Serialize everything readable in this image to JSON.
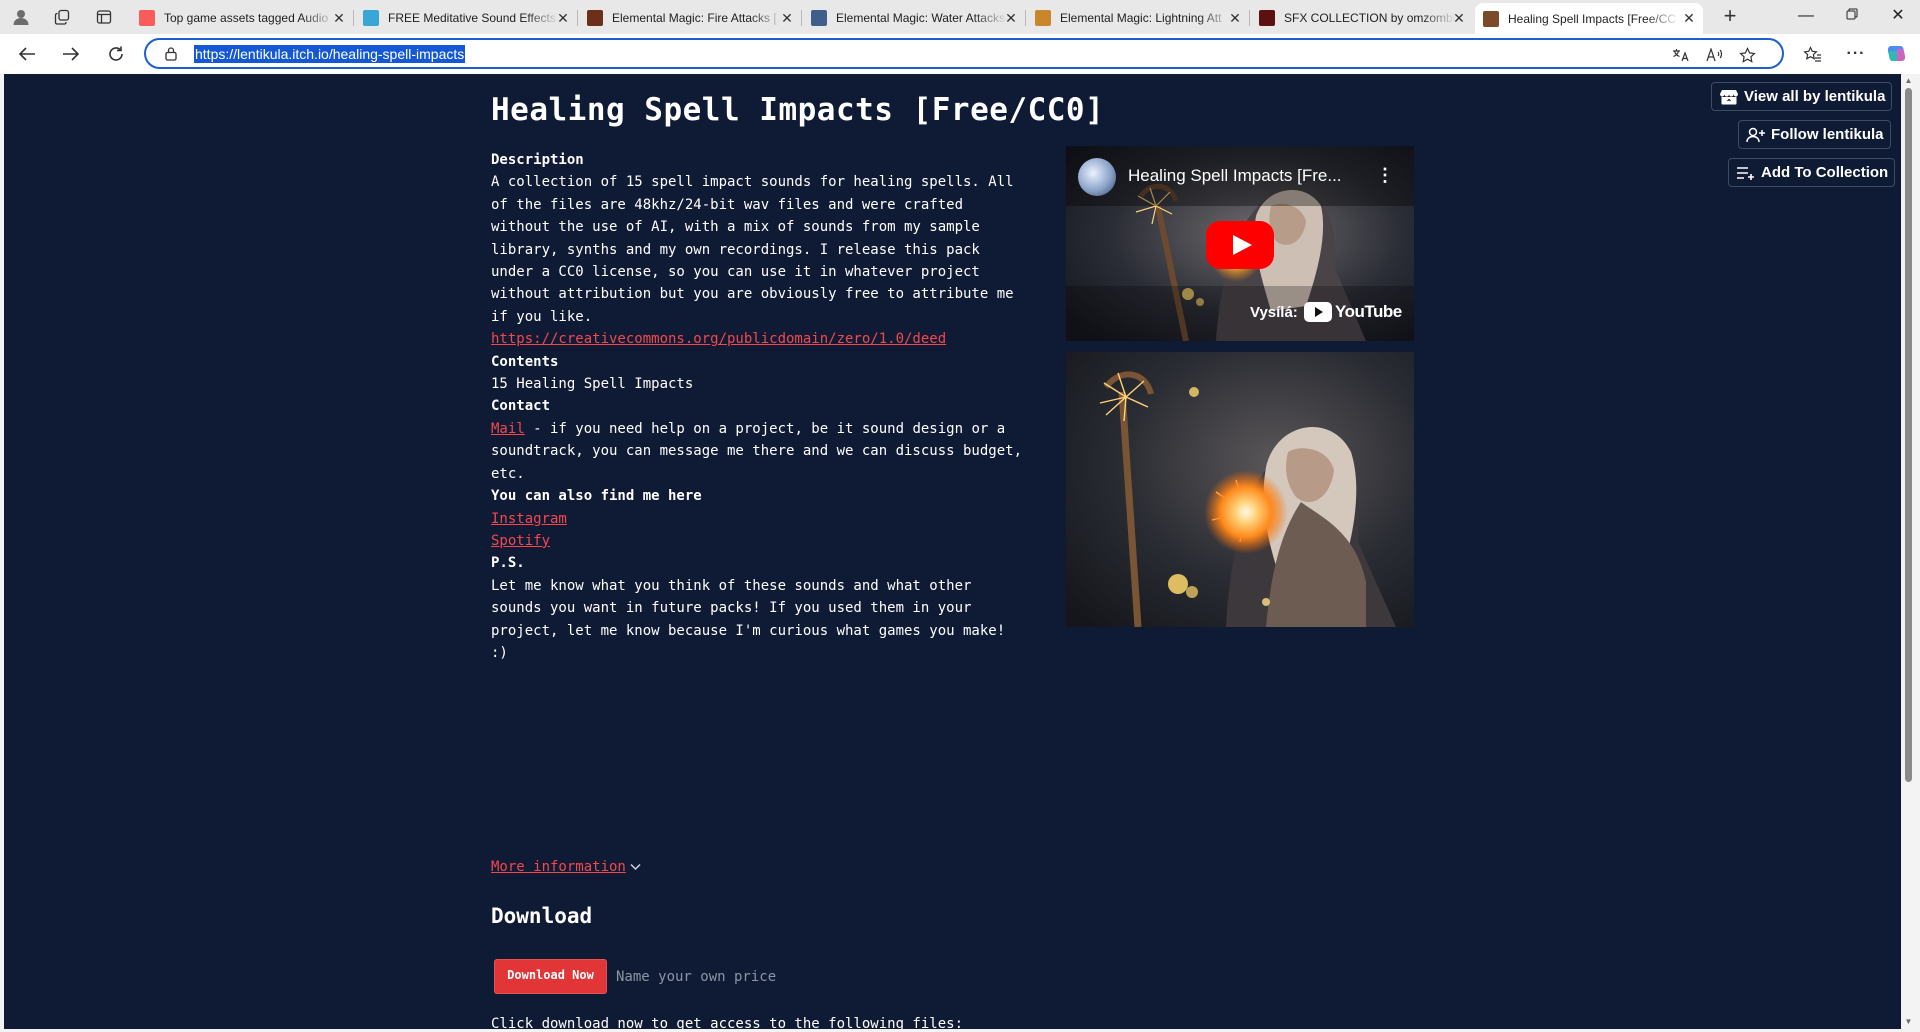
{
  "browser": {
    "tabs": [
      {
        "title": "Top game assets tagged Audio",
        "favicon_color": "#fa5c5c"
      },
      {
        "title": "FREE Meditative Sound Effects",
        "favicon_color": "#3aa6d6"
      },
      {
        "title": "Elemental Magic: Fire Attacks [",
        "favicon_color": "#6b2f1a"
      },
      {
        "title": "Elemental Magic: Water Attacks",
        "favicon_color": "#3f5f8a"
      },
      {
        "title": "Elemental Magic: Lightning Att",
        "favicon_color": "#c9872c"
      },
      {
        "title": "SFX COLLECTION by omzombie",
        "favicon_color": "#5c1010"
      },
      {
        "title": "Healing Spell Impacts [Free/CC",
        "favicon_color": "#7a4a2a"
      }
    ],
    "active_tab_index": 6,
    "url": "https://lentikula.itch.io/healing-spell-impacts",
    "accent": "#1558d6"
  },
  "page": {
    "title": "Healing Spell Impacts [Free/CC0]",
    "description_heading": "Description",
    "description_lines": [
      "A collection of 15 spell impact sounds for healing spells. All",
      "of the files are 48khz/24-bit wav files and were crafted",
      "without the use of AI, with a mix of sounds from my sample",
      "library, synths and my own recordings. I release this pack",
      "under a CC0 license, so you can use it in whatever project",
      "without attribution but you are obviously free to attribute me",
      "if you like."
    ],
    "license_link": "https://creativecommons.org/publicdomain/zero/1.0/deed",
    "contents_heading": "Contents",
    "contents_text": "15 Healing Spell Impacts",
    "contact_heading": "Contact",
    "contact_link": "Mail",
    "contact_lines": [
      " - if you need help on a project, be it sound design or a",
      "soundtrack, you can message me there and we can discuss budget,",
      "etc."
    ],
    "find_heading": "You can also find me here",
    "instagram_link": "Instagram",
    "spotify_link": "Spotify",
    "ps_heading": "P.S.",
    "ps_lines": [
      "Let me know what you think of these sounds and what other",
      "sounds you want in future packs! If you used them in your",
      "project, let me know because I'm curious what games you make!",
      ":)"
    ],
    "more_info": "More information",
    "download_heading": "Download",
    "download_button": "Download Now",
    "price_text": "Name your own price",
    "download_note": "Click download now to get access to the following files:",
    "link_color": "#f5474e",
    "background_color": "#0f1b35"
  },
  "video": {
    "title": "Healing Spell Impacts [Fre...",
    "streaming_label": "Vysílá:",
    "youtube_label": "YouTube"
  },
  "actions": {
    "view_all": "View all by lentikula",
    "follow": "Follow lentikula",
    "add_collection": "Add To Collection"
  }
}
